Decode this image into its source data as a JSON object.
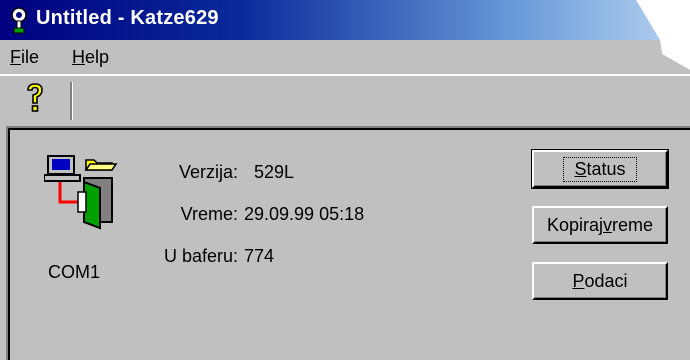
{
  "window": {
    "title": "Untitled - Katze629"
  },
  "menu": {
    "file": {
      "mnemonic": "F",
      "rest": "ile"
    },
    "help": {
      "mnemonic": "H",
      "rest": "elp"
    }
  },
  "toolbar": {
    "help_icon": "question-mark-icon"
  },
  "device": {
    "port": "COM1",
    "icon": "computer-door-icon"
  },
  "info": {
    "version_label": "Verzija:",
    "version_value": "529L",
    "time_label": "Vreme:",
    "time_value": "29.09.99 05:18",
    "buffer_label": "U baferu:",
    "buffer_value": "774"
  },
  "buttons": {
    "status": {
      "mnemonic": "S",
      "rest": "tatus"
    },
    "copy_time": {
      "before": "Kopiraj ",
      "mnemonic": "v",
      "after": "reme"
    },
    "data": {
      "mnemonic": "P",
      "rest": "odaci"
    }
  },
  "colors": {
    "face": "#c0c0c0",
    "title_start": "#000080",
    "title_end": "#b9d4f2",
    "accent_yellow": "#ffff00"
  }
}
